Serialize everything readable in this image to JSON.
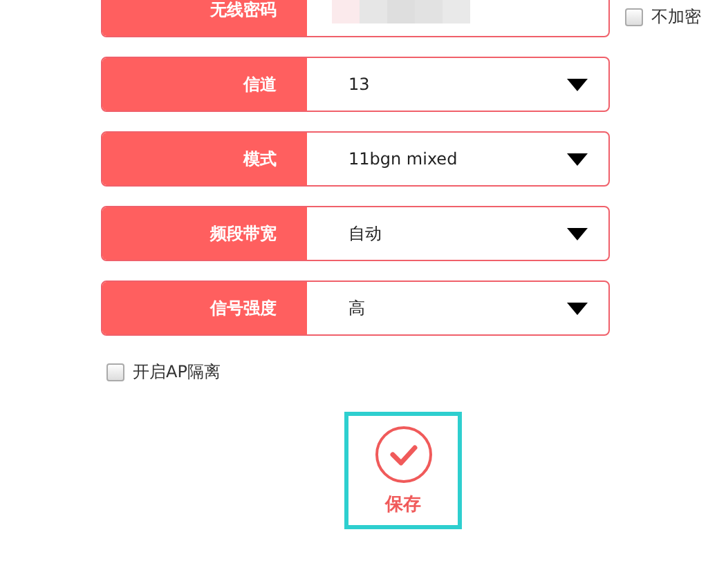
{
  "password": {
    "label": "无线密码",
    "no_encrypt": {
      "label": "不加密",
      "checked": false
    }
  },
  "selects": [
    {
      "label": "信道",
      "value": "13"
    },
    {
      "label": "模式",
      "value": "11bgn mixed"
    },
    {
      "label": "频段带宽",
      "value": "自动"
    },
    {
      "label": "信号强度",
      "value": "高"
    }
  ],
  "ap_isolation": {
    "label": "开启AP隔离",
    "checked": false
  },
  "save_button": {
    "label": "保存"
  }
}
